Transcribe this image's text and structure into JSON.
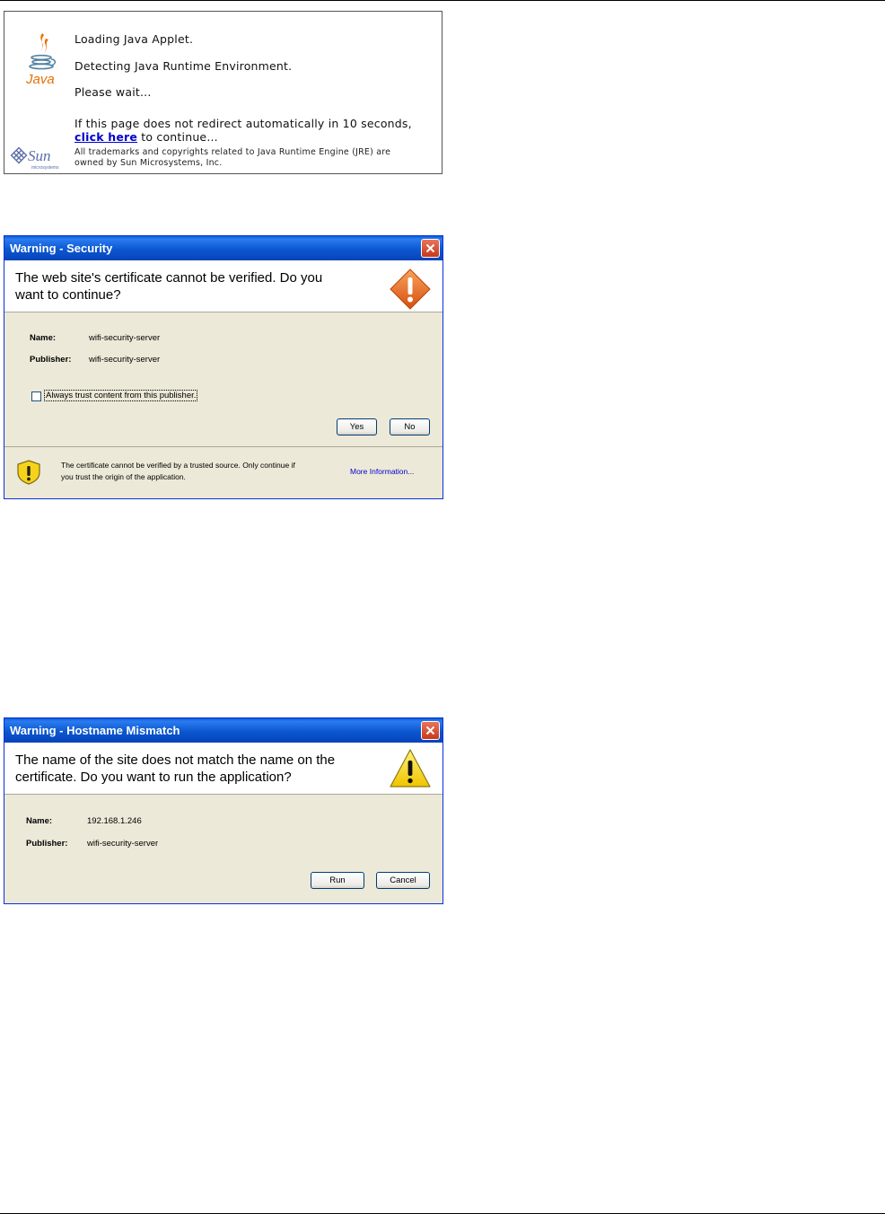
{
  "java_loader": {
    "line1": "Loading Java Applet.",
    "line2": "Detecting Java Runtime Environment.",
    "line3": "Please wait...",
    "redirect_text": "If this page does not redirect automatically in 10 seconds,",
    "link_text": "click here",
    "continue_text": " to continue...",
    "trademark_line1": "All trademarks and copyrights related to Java Runtime Engine (JRE) are",
    "trademark_line2": "owned by Sun Microsystems, Inc.",
    "java_logo_text": "Java",
    "sun_logo_text": "Sun",
    "sun_logo_subtext": "microsystems"
  },
  "security_dialog": {
    "title": "Warning - Security",
    "question_line1": "The web site's certificate cannot be verified.  Do you",
    "question_line2": "want to continue?",
    "name_label": "Name:",
    "name_value": "wifi-security-server",
    "publisher_label": "Publisher:",
    "publisher_value": "wifi-security-server",
    "checkbox_label": "Always trust content from this publisher.",
    "yes_label": "Yes",
    "no_label": "No",
    "footer_line1": "The certificate cannot be verified by a trusted source.  Only continue if",
    "footer_line2": "you trust the origin of the application.",
    "more_info": "More Information..."
  },
  "hostname_dialog": {
    "title": "Warning - Hostname Mismatch",
    "question_line1": "The name of the site does not match the name on the",
    "question_line2": "certificate.  Do you want to run the application?",
    "name_label": "Name:",
    "name_value": "192.168.1.246",
    "publisher_label": "Publisher:",
    "publisher_value": "wifi-security-server",
    "run_label": "Run",
    "cancel_label": "Cancel"
  },
  "colors": {
    "titlebar_blue": "#0a57d0",
    "dialog_bg": "#ece9d8",
    "warning_orange": "#e8621b",
    "warning_yellow": "#f6d21b",
    "link_blue": "#0000cc"
  }
}
